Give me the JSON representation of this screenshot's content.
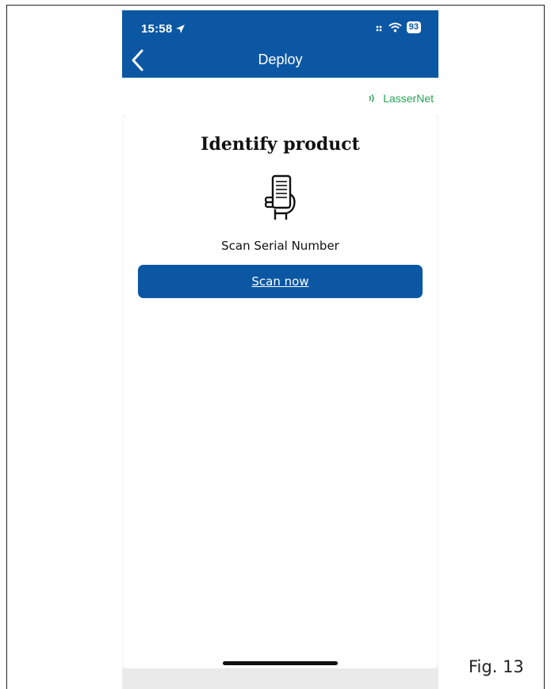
{
  "status_bar": {
    "time": "15:58",
    "battery": "93"
  },
  "header": {
    "title": "Deploy"
  },
  "connection": {
    "label": "LasserNet"
  },
  "card": {
    "title": "Identify product",
    "scan_label": "Scan Serial Number",
    "scan_button": "Scan now"
  },
  "caption": "Fig. 13",
  "colors": {
    "header_blue": "#0b57a4",
    "connection_green": "#23a455"
  },
  "icons": [
    "location-arrow-icon",
    "signal-icon",
    "wifi-icon",
    "battery-icon",
    "back-chevron-icon",
    "nfc-icon",
    "hand-phone-icon"
  ]
}
